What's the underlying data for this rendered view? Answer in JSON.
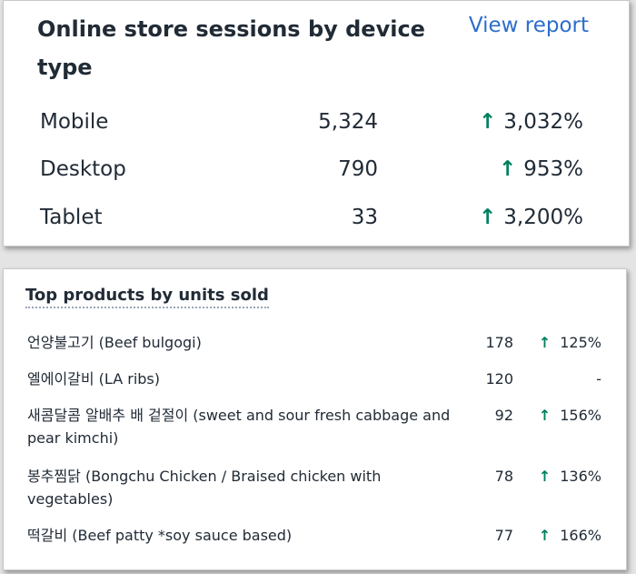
{
  "sessions_card": {
    "title": "Online store sessions by device type",
    "link": "View report",
    "rows": [
      {
        "device": "Mobile",
        "value": "5,324",
        "change": "3,032%"
      },
      {
        "device": "Desktop",
        "value": "790",
        "change": "953%"
      },
      {
        "device": "Tablet",
        "value": "33",
        "change": "3,200%"
      }
    ]
  },
  "products_card": {
    "title": "Top products by units sold",
    "rows": [
      {
        "name": "언양불고기 (Beef bulgogi)",
        "units": "178",
        "change": "125%"
      },
      {
        "name": "엘에이갈비 (LA ribs)",
        "units": "120",
        "change": "-"
      },
      {
        "name": "새콤달콤 알배추 배 겉절이 (sweet and sour fresh cabbage and pear kimchi)",
        "units": "92",
        "change": "156%"
      },
      {
        "name": "봉추찜닭 (Bongchu Chicken / Braised chicken with vegetables)",
        "units": "78",
        "change": "136%"
      },
      {
        "name": "떡갈비 (Beef patty *soy sauce based)",
        "units": "77",
        "change": "166%"
      }
    ]
  },
  "icons": {
    "up_arrow": "↑"
  },
  "colors": {
    "link": "#2c6ecb",
    "positive": "#007f5f",
    "text": "#212b36"
  }
}
